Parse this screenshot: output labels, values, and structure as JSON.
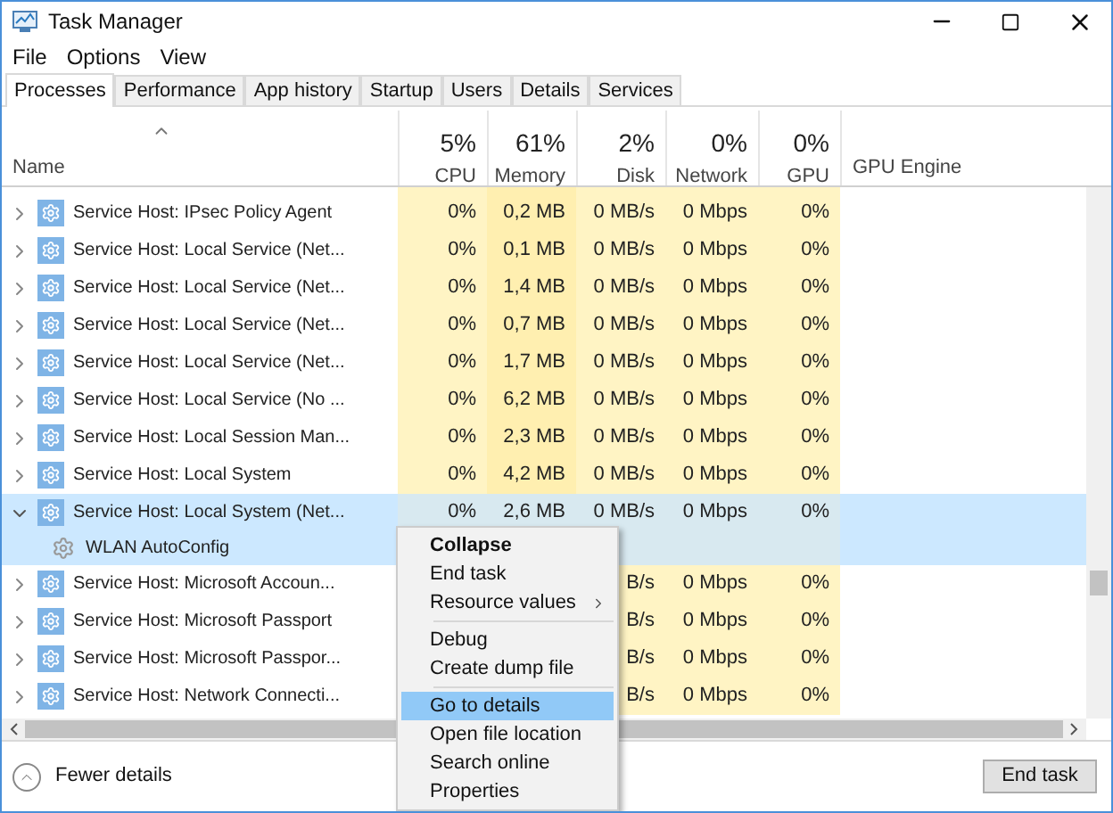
{
  "window": {
    "title": "Task Manager"
  },
  "menu_bar": [
    "File",
    "Options",
    "View"
  ],
  "tabs": [
    {
      "label": "Processes",
      "selected": true
    },
    {
      "label": "Performance",
      "selected": false
    },
    {
      "label": "App history",
      "selected": false
    },
    {
      "label": "Startup",
      "selected": false
    },
    {
      "label": "Users",
      "selected": false
    },
    {
      "label": "Details",
      "selected": false
    },
    {
      "label": "Services",
      "selected": false
    }
  ],
  "columns": [
    {
      "label": "Name"
    },
    {
      "label": "CPU",
      "percent": "5%"
    },
    {
      "label": "Memory",
      "percent": "61%"
    },
    {
      "label": "Disk",
      "percent": "2%"
    },
    {
      "label": "Network",
      "percent": "0%"
    },
    {
      "label": "GPU",
      "percent": "0%"
    },
    {
      "label": "GPU Engine"
    }
  ],
  "rows": [
    {
      "name": "Service Host: IPsec Policy Agent",
      "expanded": false,
      "selected": false,
      "cpu": "0%",
      "memory": "0,2 MB",
      "disk": "0 MB/s",
      "network": "0 Mbps",
      "gpu": "0%"
    },
    {
      "name": "Service Host: Local Service (Net...",
      "expanded": false,
      "selected": false,
      "cpu": "0%",
      "memory": "0,1 MB",
      "disk": "0 MB/s",
      "network": "0 Mbps",
      "gpu": "0%"
    },
    {
      "name": "Service Host: Local Service (Net...",
      "expanded": false,
      "selected": false,
      "cpu": "0%",
      "memory": "1,4 MB",
      "disk": "0 MB/s",
      "network": "0 Mbps",
      "gpu": "0%"
    },
    {
      "name": "Service Host: Local Service (Net...",
      "expanded": false,
      "selected": false,
      "cpu": "0%",
      "memory": "0,7 MB",
      "disk": "0 MB/s",
      "network": "0 Mbps",
      "gpu": "0%"
    },
    {
      "name": "Service Host: Local Service (Net...",
      "expanded": false,
      "selected": false,
      "cpu": "0%",
      "memory": "1,7 MB",
      "disk": "0 MB/s",
      "network": "0 Mbps",
      "gpu": "0%"
    },
    {
      "name": "Service Host: Local Service (No ...",
      "expanded": false,
      "selected": false,
      "cpu": "0%",
      "memory": "6,2 MB",
      "disk": "0 MB/s",
      "network": "0 Mbps",
      "gpu": "0%"
    },
    {
      "name": "Service Host: Local Session Man...",
      "expanded": false,
      "selected": false,
      "cpu": "0%",
      "memory": "2,3 MB",
      "disk": "0 MB/s",
      "network": "0 Mbps",
      "gpu": "0%"
    },
    {
      "name": "Service Host: Local System",
      "expanded": false,
      "selected": false,
      "cpu": "0%",
      "memory": "4,2 MB",
      "disk": "0 MB/s",
      "network": "0 Mbps",
      "gpu": "0%"
    },
    {
      "name": "Service Host: Local System (Net...",
      "expanded": true,
      "selected": true,
      "cpu": "0%",
      "memory": "2,6 MB",
      "disk": "0 MB/s",
      "network": "0 Mbps",
      "gpu": "0%",
      "children": [
        {
          "name": "WLAN AutoConfig"
        }
      ]
    },
    {
      "name": "Service Host: Microsoft Accoun...",
      "expanded": false,
      "selected": false,
      "disk": "B/s",
      "network": "0 Mbps",
      "gpu": "0%"
    },
    {
      "name": "Service Host: Microsoft Passport",
      "expanded": false,
      "selected": false,
      "disk": "B/s",
      "network": "0 Mbps",
      "gpu": "0%"
    },
    {
      "name": "Service Host: Microsoft Passpor...",
      "expanded": false,
      "selected": false,
      "disk": "B/s",
      "network": "0 Mbps",
      "gpu": "0%"
    },
    {
      "name": "Service Host: Network Connecti...",
      "expanded": false,
      "selected": false,
      "disk": "B/s",
      "network": "0 Mbps",
      "gpu": "0%"
    }
  ],
  "context_menu": [
    {
      "kind": "item",
      "label": "Collapse",
      "bold": true,
      "selected": false,
      "submenu": false
    },
    {
      "kind": "item",
      "label": "End task",
      "bold": false,
      "selected": false,
      "submenu": false
    },
    {
      "kind": "item",
      "label": "Resource values",
      "bold": false,
      "selected": false,
      "submenu": true
    },
    {
      "kind": "separator"
    },
    {
      "kind": "item",
      "label": "Debug",
      "bold": false,
      "selected": false,
      "submenu": false
    },
    {
      "kind": "item",
      "label": "Create dump file",
      "bold": false,
      "selected": false,
      "submenu": false
    },
    {
      "kind": "separator"
    },
    {
      "kind": "item",
      "label": "Go to details",
      "bold": false,
      "selected": true,
      "submenu": false
    },
    {
      "kind": "item",
      "label": "Open file location",
      "bold": false,
      "selected": false,
      "submenu": false
    },
    {
      "kind": "item",
      "label": "Search online",
      "bold": false,
      "selected": false,
      "submenu": false
    },
    {
      "kind": "item",
      "label": "Properties",
      "bold": false,
      "selected": false,
      "submenu": false
    }
  ],
  "footer": {
    "fewer_details": "Fewer details",
    "end_task": "End task"
  }
}
